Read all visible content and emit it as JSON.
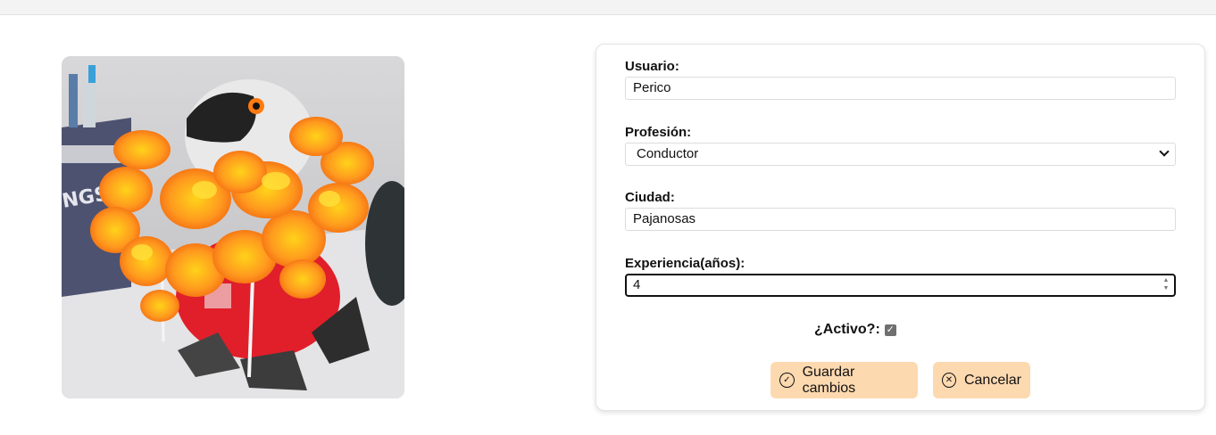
{
  "form": {
    "usuario": {
      "label": "Usuario:",
      "value": "Perico"
    },
    "profesion": {
      "label": "Profesión:",
      "value": "Conductor"
    },
    "ciudad": {
      "label": "Ciudad:",
      "value": "Pajanosas"
    },
    "experiencia": {
      "label": "Experiencia(años):",
      "value": "4"
    },
    "activo": {
      "label": "¿Activo?:",
      "checked": true
    },
    "buttons": {
      "save": {
        "label": "Guardar cambios",
        "icon": "check-circle-icon"
      },
      "cancel": {
        "label": "Cancelar",
        "icon": "x-circle-icon"
      }
    }
  },
  "colors": {
    "button_bg": "#fdd9b0",
    "checkbox_bg": "#6f6f6f"
  }
}
